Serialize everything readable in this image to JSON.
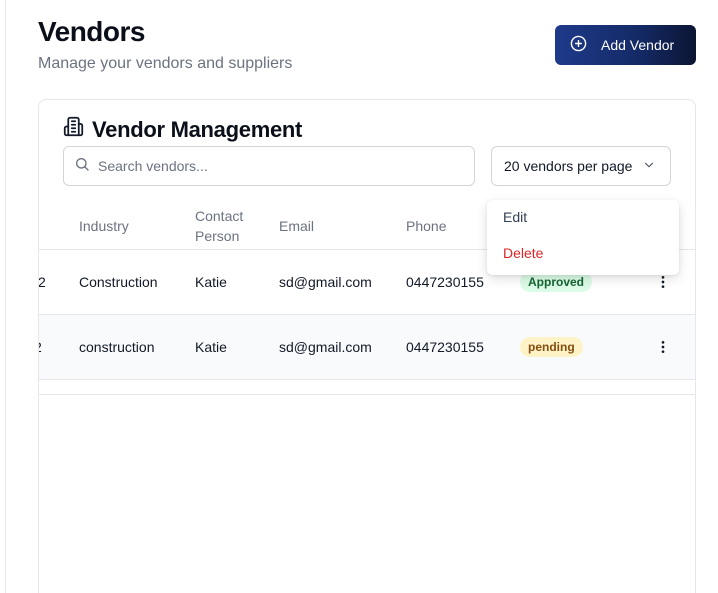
{
  "header": {
    "title": "Vendors",
    "subtitle": "Manage your vendors and suppliers",
    "add_button_label": "Add Vendor"
  },
  "card": {
    "title": "Vendor Management",
    "search_placeholder": "Search vendors...",
    "per_page_label": "20 vendors per page"
  },
  "table": {
    "columns": {
      "industry": "Industry",
      "contact_line1": "Contact",
      "contact_line2": "Person",
      "email": "Email",
      "phone": "Phone"
    },
    "rows": [
      {
        "name_tail": "2",
        "industry": "Construction",
        "contact": "Katie",
        "email": "sd@gmail.com",
        "phone": "0447230155",
        "status": "Approved"
      },
      {
        "name_tail": "2",
        "industry": "construction",
        "contact": "Katie",
        "email": "sd@gmail.com",
        "phone": "0447230155",
        "status": "pending"
      }
    ]
  },
  "menu": {
    "edit": "Edit",
    "delete": "Delete"
  },
  "icons": {
    "add": "plus-circle-icon",
    "card": "building-icon",
    "search": "search-icon",
    "dropdown": "chevron-down-icon",
    "row_actions": "more-vertical-icon"
  },
  "colors": {
    "primary": "#1e3a8a",
    "approved_bg": "#dcfce7",
    "approved_text": "#166534",
    "pending_bg": "#fef3c7",
    "pending_text": "#854d0e",
    "delete": "#dc2626"
  }
}
